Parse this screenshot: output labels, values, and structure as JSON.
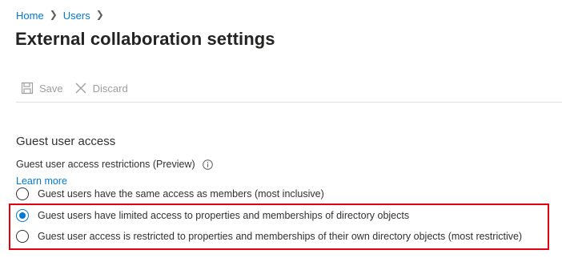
{
  "breadcrumb": {
    "items": [
      {
        "label": "Home"
      },
      {
        "label": "Users"
      }
    ]
  },
  "page": {
    "title": "External collaboration settings"
  },
  "toolbar": {
    "save_label": "Save",
    "discard_label": "Discard",
    "save_icon": "save-icon",
    "discard_icon": "close-icon",
    "disabled_color": "#a19f9d"
  },
  "guest_access": {
    "section_title": "Guest user access",
    "field_label": "Guest user access restrictions (Preview)",
    "info_icon": "info-icon",
    "learn_more_label": "Learn more",
    "options": [
      {
        "label": "Guest users have the same access as members (most inclusive)",
        "selected": false
      },
      {
        "label": "Guest users have limited access to properties and memberships of directory objects",
        "selected": true
      },
      {
        "label": "Guest user access is restricted to properties and memberships of their own directory objects (most restrictive)",
        "selected": false
      }
    ]
  },
  "colors": {
    "accent": "#0078d4",
    "highlight_border": "#e3000f",
    "text": "#323130"
  }
}
